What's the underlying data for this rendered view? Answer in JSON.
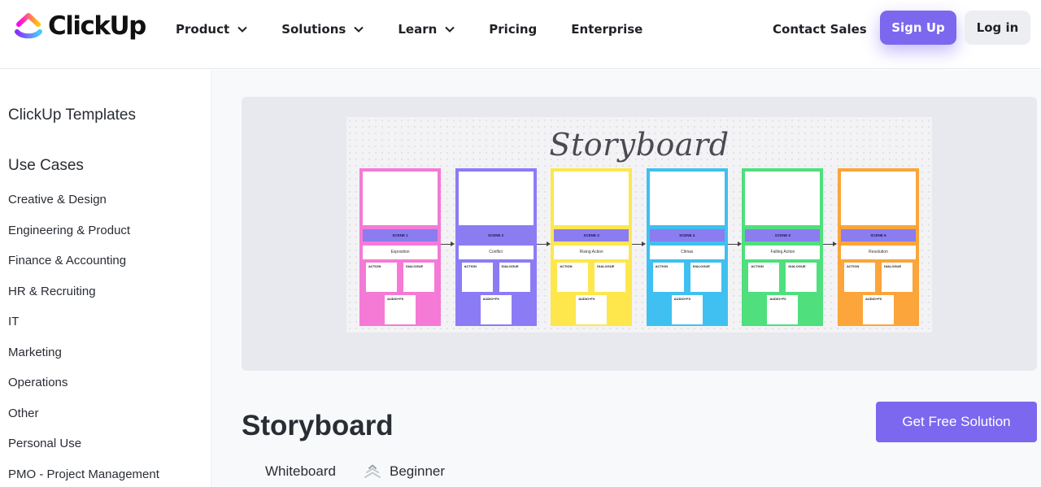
{
  "header": {
    "logo_text": "ClickUp",
    "nav": [
      {
        "label": "Product",
        "has_dropdown": true
      },
      {
        "label": "Solutions",
        "has_dropdown": true
      },
      {
        "label": "Learn",
        "has_dropdown": true
      },
      {
        "label": "Pricing",
        "has_dropdown": false
      },
      {
        "label": "Enterprise",
        "has_dropdown": false
      }
    ],
    "contact_label": "Contact Sales",
    "signup_label": "Sign Up",
    "login_label": "Log in"
  },
  "sidebar": {
    "templates_label": "ClickUp Templates",
    "use_cases_label": "Use Cases",
    "items": [
      "Creative & Design",
      "Engineering & Product",
      "Finance & Accounting",
      "HR & Recruiting",
      "IT",
      "Marketing",
      "Operations",
      "Other",
      "Personal Use",
      "PMO - Project Management"
    ]
  },
  "preview": {
    "board_title": "Storyboard",
    "note_labels": {
      "action": "ACTION",
      "dialogue": "DIALOGUE",
      "audio": "AUDIO+FX"
    },
    "scenes": [
      {
        "label": "SCENE 1",
        "desc": "Exposition",
        "color": "#f57ad6"
      },
      {
        "label": "SCENE 2",
        "desc": "Conflict",
        "color": "#8b7cf6"
      },
      {
        "label": "SCENE 3",
        "desc": "Rising Action",
        "color": "#fde74c"
      },
      {
        "label": "SCENE 4",
        "desc": "Climax",
        "color": "#3fc0f0"
      },
      {
        "label": "SCENE 5",
        "desc": "Falling Action",
        "color": "#4fdf7c"
      },
      {
        "label": "SCENE 6",
        "desc": "Resolution",
        "color": "#fba53a"
      }
    ]
  },
  "template": {
    "title": "Storyboard",
    "cta_label": "Get Free Solution",
    "type": "Whiteboard",
    "level": "Beginner"
  },
  "colors": {
    "accent": "#7b68ee",
    "logo_gradient": [
      "#8930fd",
      "#49ccf9",
      "#ff02f0",
      "#ffc800"
    ]
  },
  "icons": [
    "clickup-logo-icon",
    "chevron-down-icon",
    "beginner-level-icon",
    "arrow-right-icon"
  ]
}
